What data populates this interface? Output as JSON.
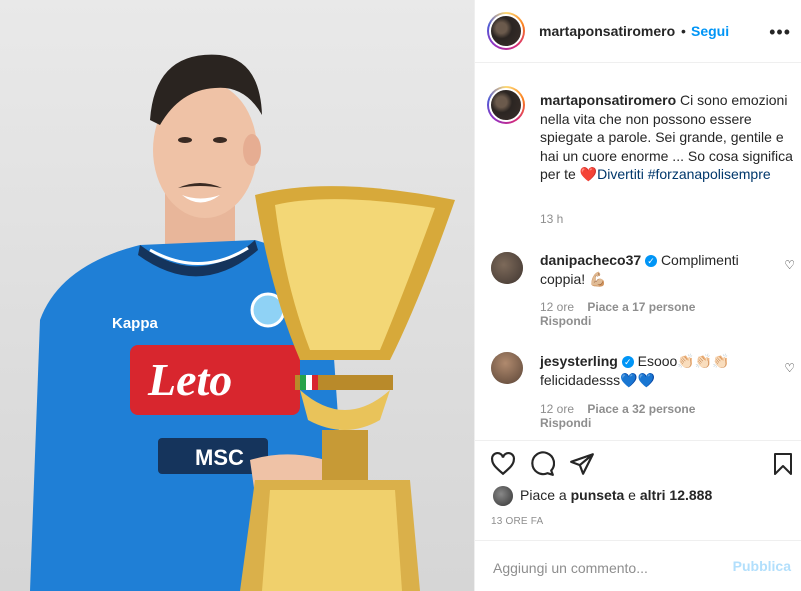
{
  "post": {
    "username": "martaponsatiromero",
    "follow_label": "Segui",
    "more_label": "•••"
  },
  "caption": {
    "username": "martaponsatiromero",
    "text": "Ci sono emozioni nella vita che non possono essere spiegate a parole. Sei grande, gentile e hai un cuore enorme ... So cosa significa per te ",
    "emoji": "❤️",
    "tag1": "Divertiti",
    "tag2": "#forzanapolisempre",
    "time": "13 h"
  },
  "comments": [
    {
      "username": "danipacheco37",
      "text": "Complimenti coppia! 💪🏼",
      "time": "12 ore",
      "likes": "Piace a 17 persone",
      "reply": "Rispondi"
    },
    {
      "username": "jesysterling",
      "text": "Esooo👏🏻👏🏻👏🏻 felicidadesss💙💙",
      "time": "12 ore",
      "likes": "Piace a 32 persone",
      "reply": "Rispondi"
    }
  ],
  "likes": {
    "prefix": "Piace a ",
    "user": "punseta",
    "middle": " e ",
    "others": "altri 12.888"
  },
  "timestamp": "13 ORE FA",
  "comment_input": {
    "placeholder": "Aggiungi un commento...",
    "publish_label": "Pubblica"
  },
  "photo": {
    "jersey_sponsor": "Leto",
    "jersey_sponsor2": "MSC",
    "jersey_brand": "Kappa"
  },
  "colors": {
    "accent": "#0095f6",
    "publish_disabled": "#b2dffc",
    "jersey": "#1f7fd6"
  },
  "icons": [
    "heart-icon",
    "comment-icon",
    "share-icon",
    "bookmark-icon",
    "more-icon",
    "verified-icon"
  ]
}
